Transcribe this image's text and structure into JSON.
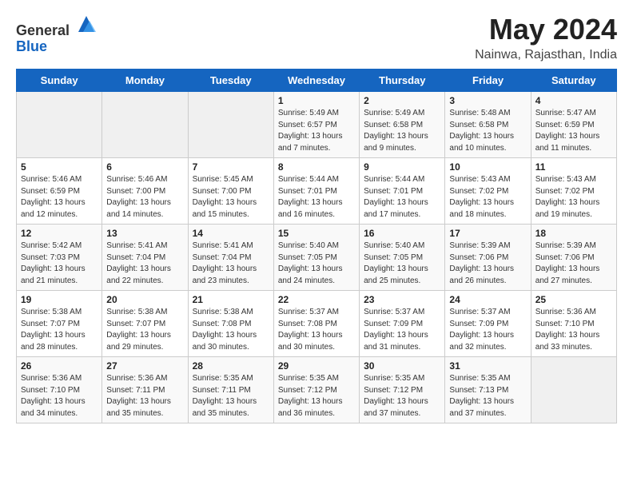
{
  "header": {
    "logo_general": "General",
    "logo_blue": "Blue",
    "title": "May 2024",
    "subtitle": "Nainwa, Rajasthan, India"
  },
  "days_of_week": [
    "Sunday",
    "Monday",
    "Tuesday",
    "Wednesday",
    "Thursday",
    "Friday",
    "Saturday"
  ],
  "weeks": [
    [
      {
        "day": "",
        "info": ""
      },
      {
        "day": "",
        "info": ""
      },
      {
        "day": "",
        "info": ""
      },
      {
        "day": "1",
        "info": "Sunrise: 5:49 AM\nSunset: 6:57 PM\nDaylight: 13 hours\nand 7 minutes."
      },
      {
        "day": "2",
        "info": "Sunrise: 5:49 AM\nSunset: 6:58 PM\nDaylight: 13 hours\nand 9 minutes."
      },
      {
        "day": "3",
        "info": "Sunrise: 5:48 AM\nSunset: 6:58 PM\nDaylight: 13 hours\nand 10 minutes."
      },
      {
        "day": "4",
        "info": "Sunrise: 5:47 AM\nSunset: 6:59 PM\nDaylight: 13 hours\nand 11 minutes."
      }
    ],
    [
      {
        "day": "5",
        "info": "Sunrise: 5:46 AM\nSunset: 6:59 PM\nDaylight: 13 hours\nand 12 minutes."
      },
      {
        "day": "6",
        "info": "Sunrise: 5:46 AM\nSunset: 7:00 PM\nDaylight: 13 hours\nand 14 minutes."
      },
      {
        "day": "7",
        "info": "Sunrise: 5:45 AM\nSunset: 7:00 PM\nDaylight: 13 hours\nand 15 minutes."
      },
      {
        "day": "8",
        "info": "Sunrise: 5:44 AM\nSunset: 7:01 PM\nDaylight: 13 hours\nand 16 minutes."
      },
      {
        "day": "9",
        "info": "Sunrise: 5:44 AM\nSunset: 7:01 PM\nDaylight: 13 hours\nand 17 minutes."
      },
      {
        "day": "10",
        "info": "Sunrise: 5:43 AM\nSunset: 7:02 PM\nDaylight: 13 hours\nand 18 minutes."
      },
      {
        "day": "11",
        "info": "Sunrise: 5:43 AM\nSunset: 7:02 PM\nDaylight: 13 hours\nand 19 minutes."
      }
    ],
    [
      {
        "day": "12",
        "info": "Sunrise: 5:42 AM\nSunset: 7:03 PM\nDaylight: 13 hours\nand 21 minutes."
      },
      {
        "day": "13",
        "info": "Sunrise: 5:41 AM\nSunset: 7:04 PM\nDaylight: 13 hours\nand 22 minutes."
      },
      {
        "day": "14",
        "info": "Sunrise: 5:41 AM\nSunset: 7:04 PM\nDaylight: 13 hours\nand 23 minutes."
      },
      {
        "day": "15",
        "info": "Sunrise: 5:40 AM\nSunset: 7:05 PM\nDaylight: 13 hours\nand 24 minutes."
      },
      {
        "day": "16",
        "info": "Sunrise: 5:40 AM\nSunset: 7:05 PM\nDaylight: 13 hours\nand 25 minutes."
      },
      {
        "day": "17",
        "info": "Sunrise: 5:39 AM\nSunset: 7:06 PM\nDaylight: 13 hours\nand 26 minutes."
      },
      {
        "day": "18",
        "info": "Sunrise: 5:39 AM\nSunset: 7:06 PM\nDaylight: 13 hours\nand 27 minutes."
      }
    ],
    [
      {
        "day": "19",
        "info": "Sunrise: 5:38 AM\nSunset: 7:07 PM\nDaylight: 13 hours\nand 28 minutes."
      },
      {
        "day": "20",
        "info": "Sunrise: 5:38 AM\nSunset: 7:07 PM\nDaylight: 13 hours\nand 29 minutes."
      },
      {
        "day": "21",
        "info": "Sunrise: 5:38 AM\nSunset: 7:08 PM\nDaylight: 13 hours\nand 30 minutes."
      },
      {
        "day": "22",
        "info": "Sunrise: 5:37 AM\nSunset: 7:08 PM\nDaylight: 13 hours\nand 30 minutes."
      },
      {
        "day": "23",
        "info": "Sunrise: 5:37 AM\nSunset: 7:09 PM\nDaylight: 13 hours\nand 31 minutes."
      },
      {
        "day": "24",
        "info": "Sunrise: 5:37 AM\nSunset: 7:09 PM\nDaylight: 13 hours\nand 32 minutes."
      },
      {
        "day": "25",
        "info": "Sunrise: 5:36 AM\nSunset: 7:10 PM\nDaylight: 13 hours\nand 33 minutes."
      }
    ],
    [
      {
        "day": "26",
        "info": "Sunrise: 5:36 AM\nSunset: 7:10 PM\nDaylight: 13 hours\nand 34 minutes."
      },
      {
        "day": "27",
        "info": "Sunrise: 5:36 AM\nSunset: 7:11 PM\nDaylight: 13 hours\nand 35 minutes."
      },
      {
        "day": "28",
        "info": "Sunrise: 5:35 AM\nSunset: 7:11 PM\nDaylight: 13 hours\nand 35 minutes."
      },
      {
        "day": "29",
        "info": "Sunrise: 5:35 AM\nSunset: 7:12 PM\nDaylight: 13 hours\nand 36 minutes."
      },
      {
        "day": "30",
        "info": "Sunrise: 5:35 AM\nSunset: 7:12 PM\nDaylight: 13 hours\nand 37 minutes."
      },
      {
        "day": "31",
        "info": "Sunrise: 5:35 AM\nSunset: 7:13 PM\nDaylight: 13 hours\nand 37 minutes."
      },
      {
        "day": "",
        "info": ""
      }
    ]
  ]
}
